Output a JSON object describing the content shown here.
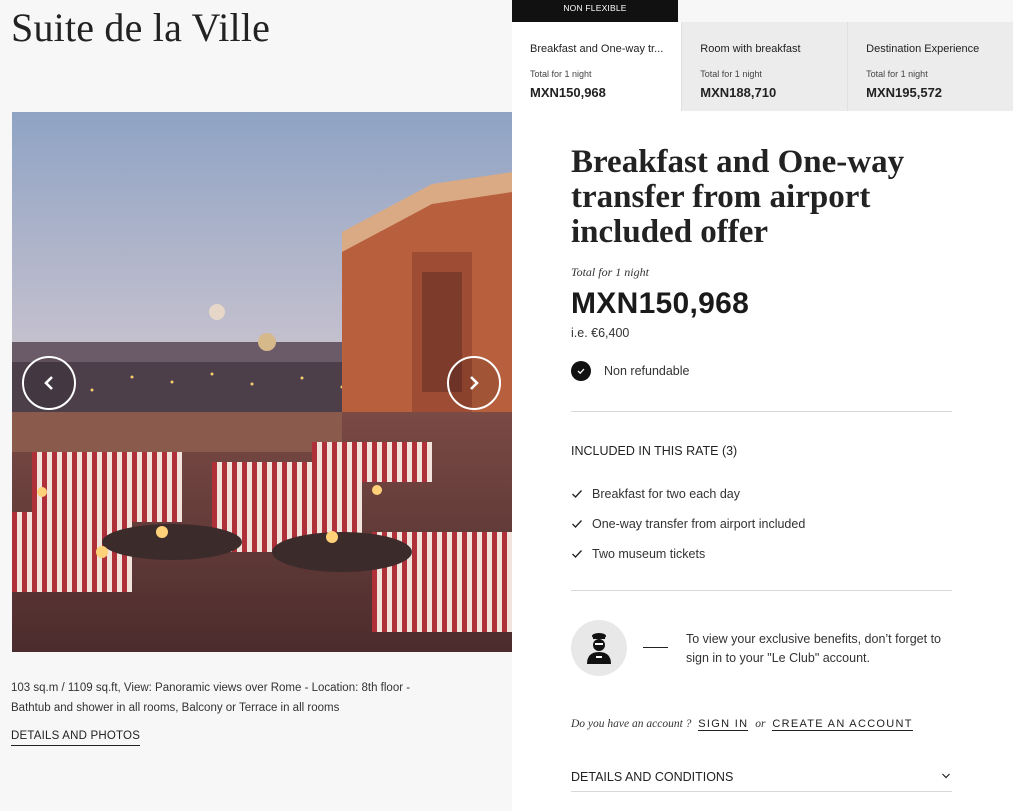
{
  "room": {
    "title": "Suite de la Ville",
    "description": "103 sq.m / 1109 sq.ft, View: Panoramic views over Rome - Location: 8th floor - Bathtub and shower in all rooms, Balcony or Terrace in all rooms",
    "details_link": "DETAILS AND PHOTOS"
  },
  "gallery": {
    "prev_icon": "chevron-left-icon",
    "next_icon": "chevron-right-icon"
  },
  "rate_badge": "NON FLEXIBLE",
  "rate_tabs": [
    {
      "name": "Breakfast and One-way tr...",
      "total": "Total for 1 night",
      "price": "MXN150,968"
    },
    {
      "name": "Room with breakfast",
      "total": "Total for 1 night",
      "price": "MXN188,710"
    },
    {
      "name": "Destination Experience",
      "total": "Total for 1 night",
      "price": "MXN195,572"
    }
  ],
  "offer": {
    "title": "Breakfast and One-way transfer from airport included offer",
    "total_label": "Total for 1 night",
    "price": "MXN150,968",
    "price_eur": "i.e. €6,400",
    "refund_status": "Non refundable"
  },
  "included": {
    "title": "INCLUDED IN THIS RATE (3)",
    "items": [
      "Breakfast for two each day",
      "One-way transfer from airport included",
      "Two museum tickets"
    ]
  },
  "club": {
    "text": "To view your exclusive benefits, don’t forget to sign in to your \"Le Club\" account.",
    "question": "Do you have an account ?",
    "sign_in": "SIGN IN",
    "or": "or",
    "create_account": "CREATE AN ACCOUNT"
  },
  "conditions": {
    "label": "DETAILS AND CONDITIONS"
  },
  "colors": {
    "accent": "#111111",
    "panel": "#ffffff",
    "tab_inactive": "#ececec",
    "background": "#f7f7f7"
  }
}
